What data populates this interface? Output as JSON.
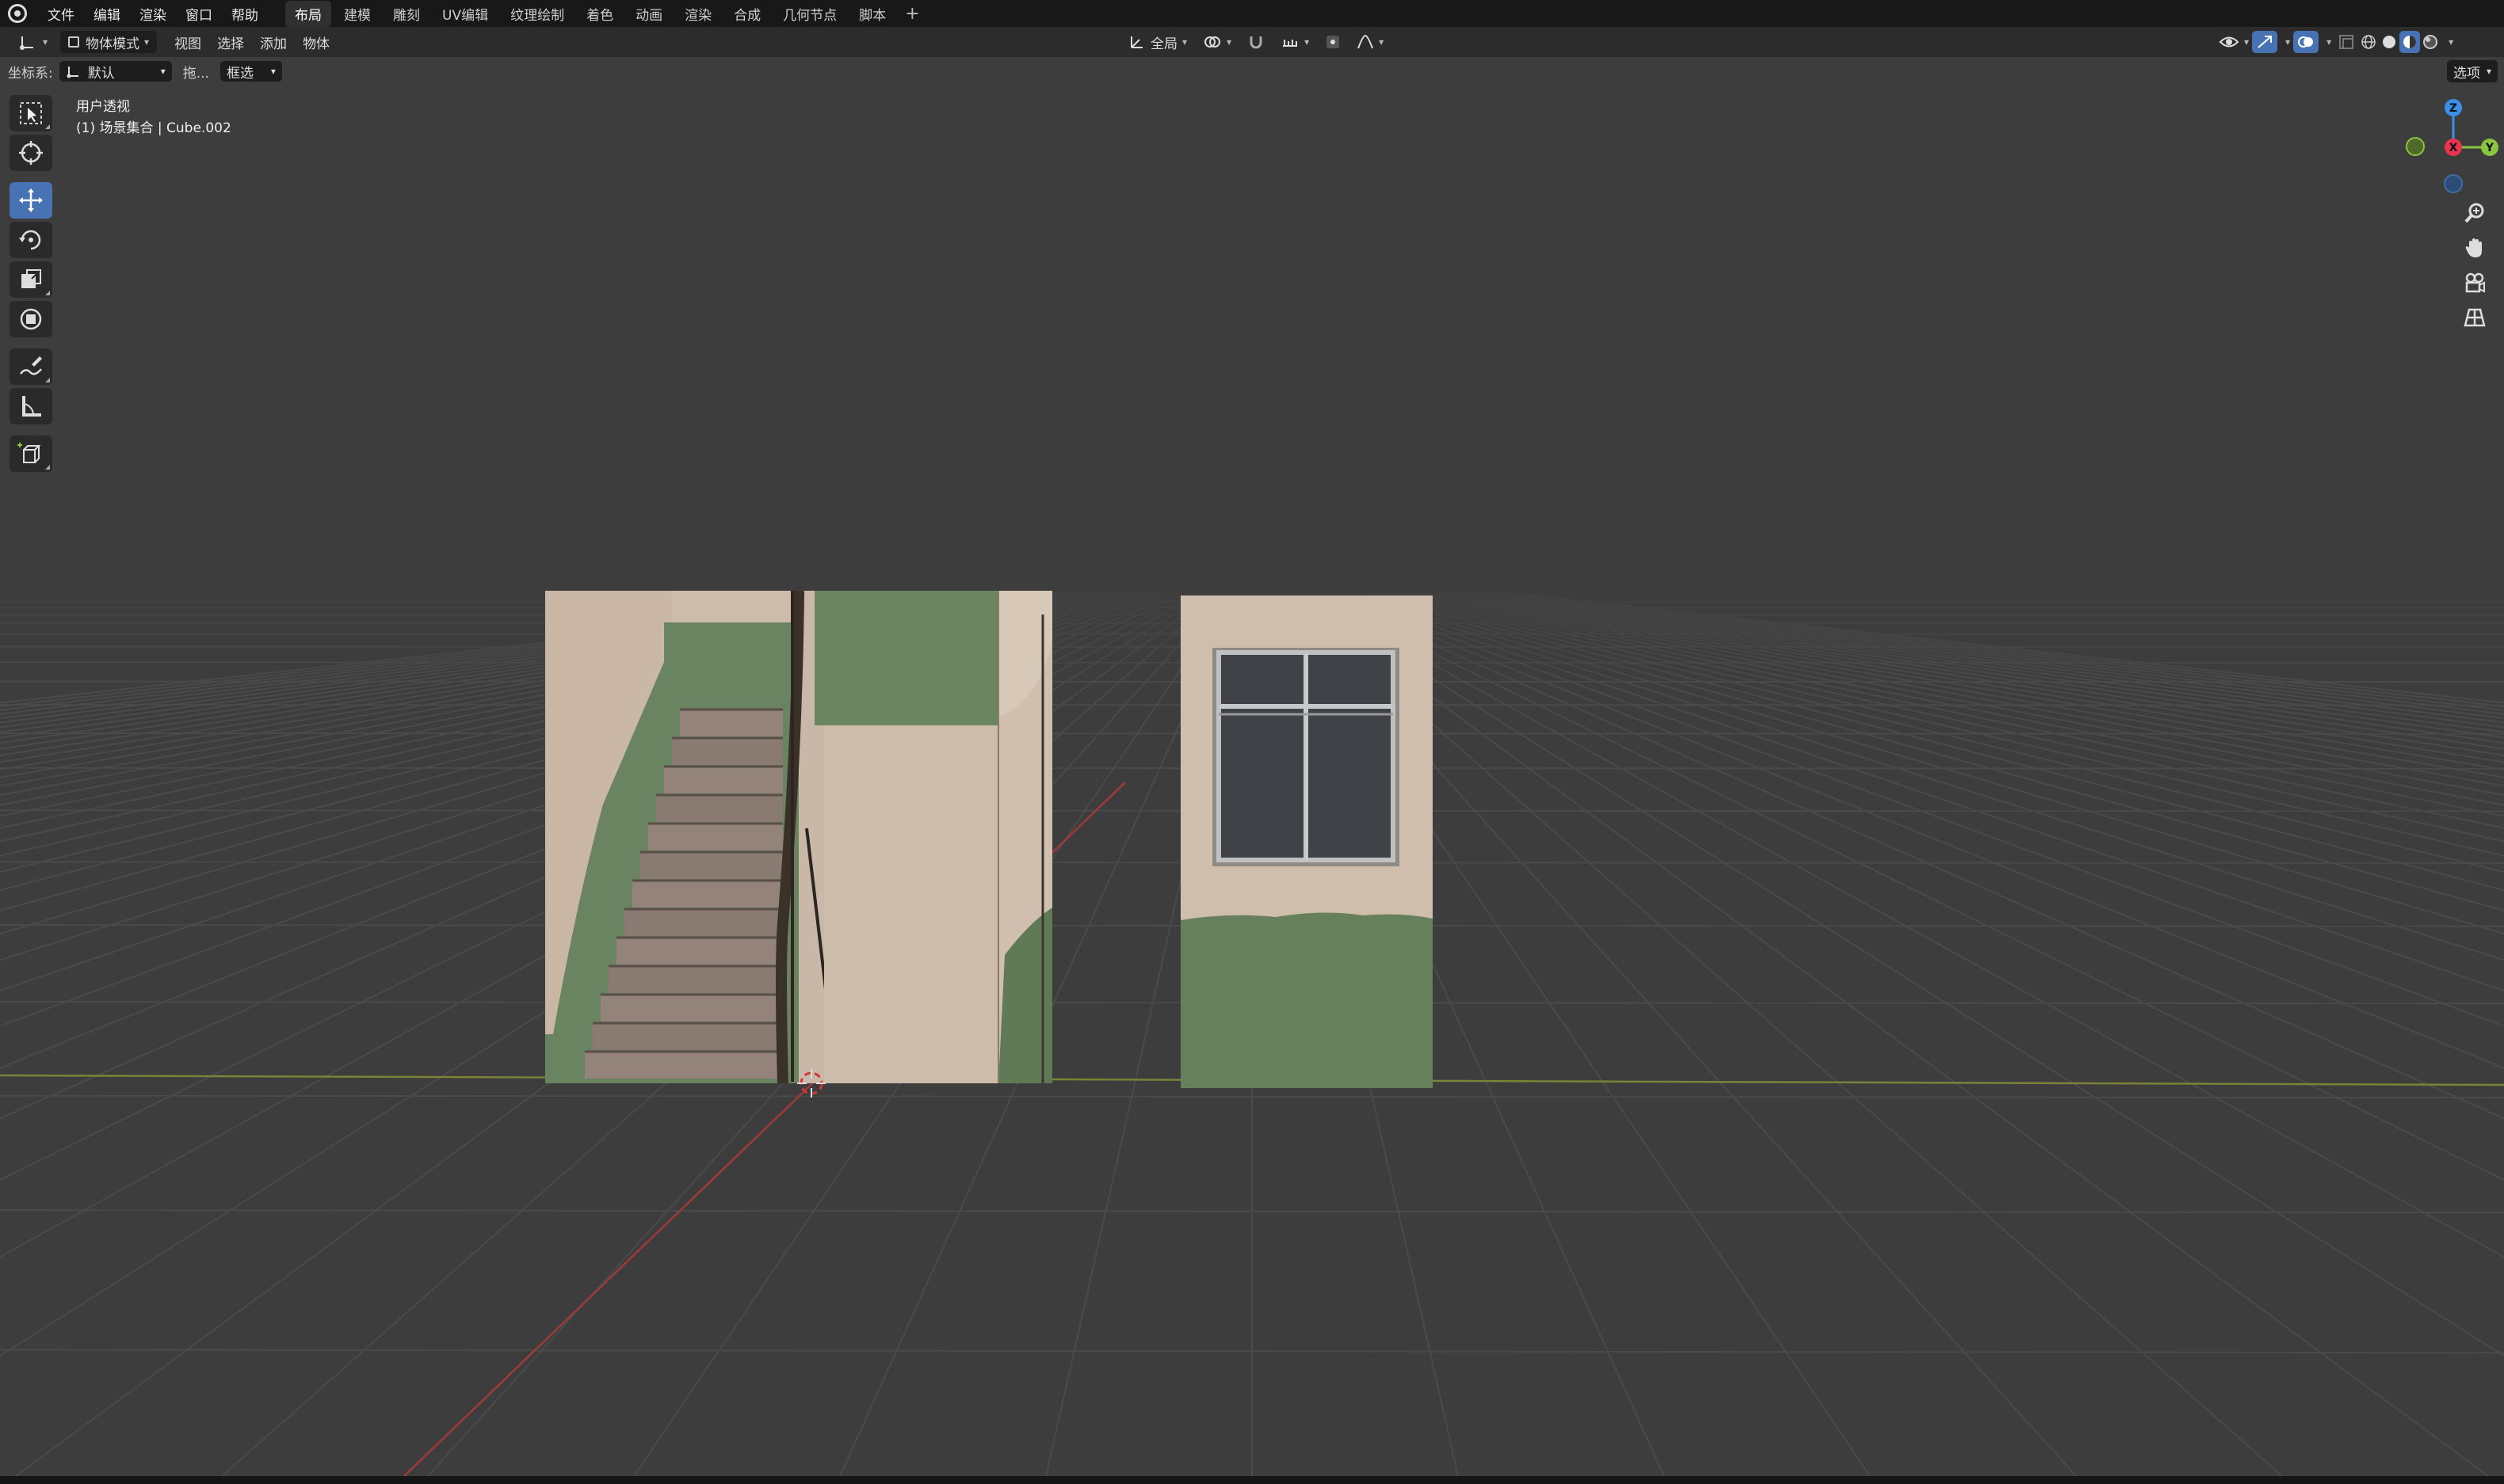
{
  "menubar": {
    "items": [
      "文件",
      "编辑",
      "渲染",
      "窗口",
      "帮助"
    ],
    "workspaces": [
      "布局",
      "建模",
      "雕刻",
      "UV编辑",
      "纹理绘制",
      "着色",
      "动画",
      "渲染",
      "合成",
      "几何节点",
      "脚本"
    ],
    "active_workspace": "布局",
    "add_label": "+"
  },
  "header": {
    "mode": "物体模式",
    "menus": [
      "视图",
      "选择",
      "添加",
      "物体"
    ],
    "transform_orientation": "全局"
  },
  "toolrow": {
    "coord_label": "坐标系:",
    "coord_value": "默认",
    "drag_label": "拖...",
    "select_mode": "框选",
    "options_label": "选项"
  },
  "viewport": {
    "view_name": "用户透视",
    "collection_info": "(1) 场景集合 | Cube.002"
  },
  "gizmo": {
    "x": "X",
    "y": "Y",
    "z": "Z"
  },
  "colors": {
    "bg": "#3d3d3d",
    "grid": "#4a4a4a",
    "x_axis": "#b33a3a",
    "y_axis": "#8a9a3a",
    "x_gizmo": "#e8344f",
    "y_gizmo": "#8bc53f",
    "z_gizmo": "#3d8ee8",
    "accent": "#4772b3"
  },
  "tools": [
    "select-box-icon",
    "cursor-icon",
    "move-icon",
    "rotate-icon",
    "scale-icon",
    "transform-icon",
    "annotate-icon",
    "measure-icon",
    "add-cube-icon"
  ]
}
